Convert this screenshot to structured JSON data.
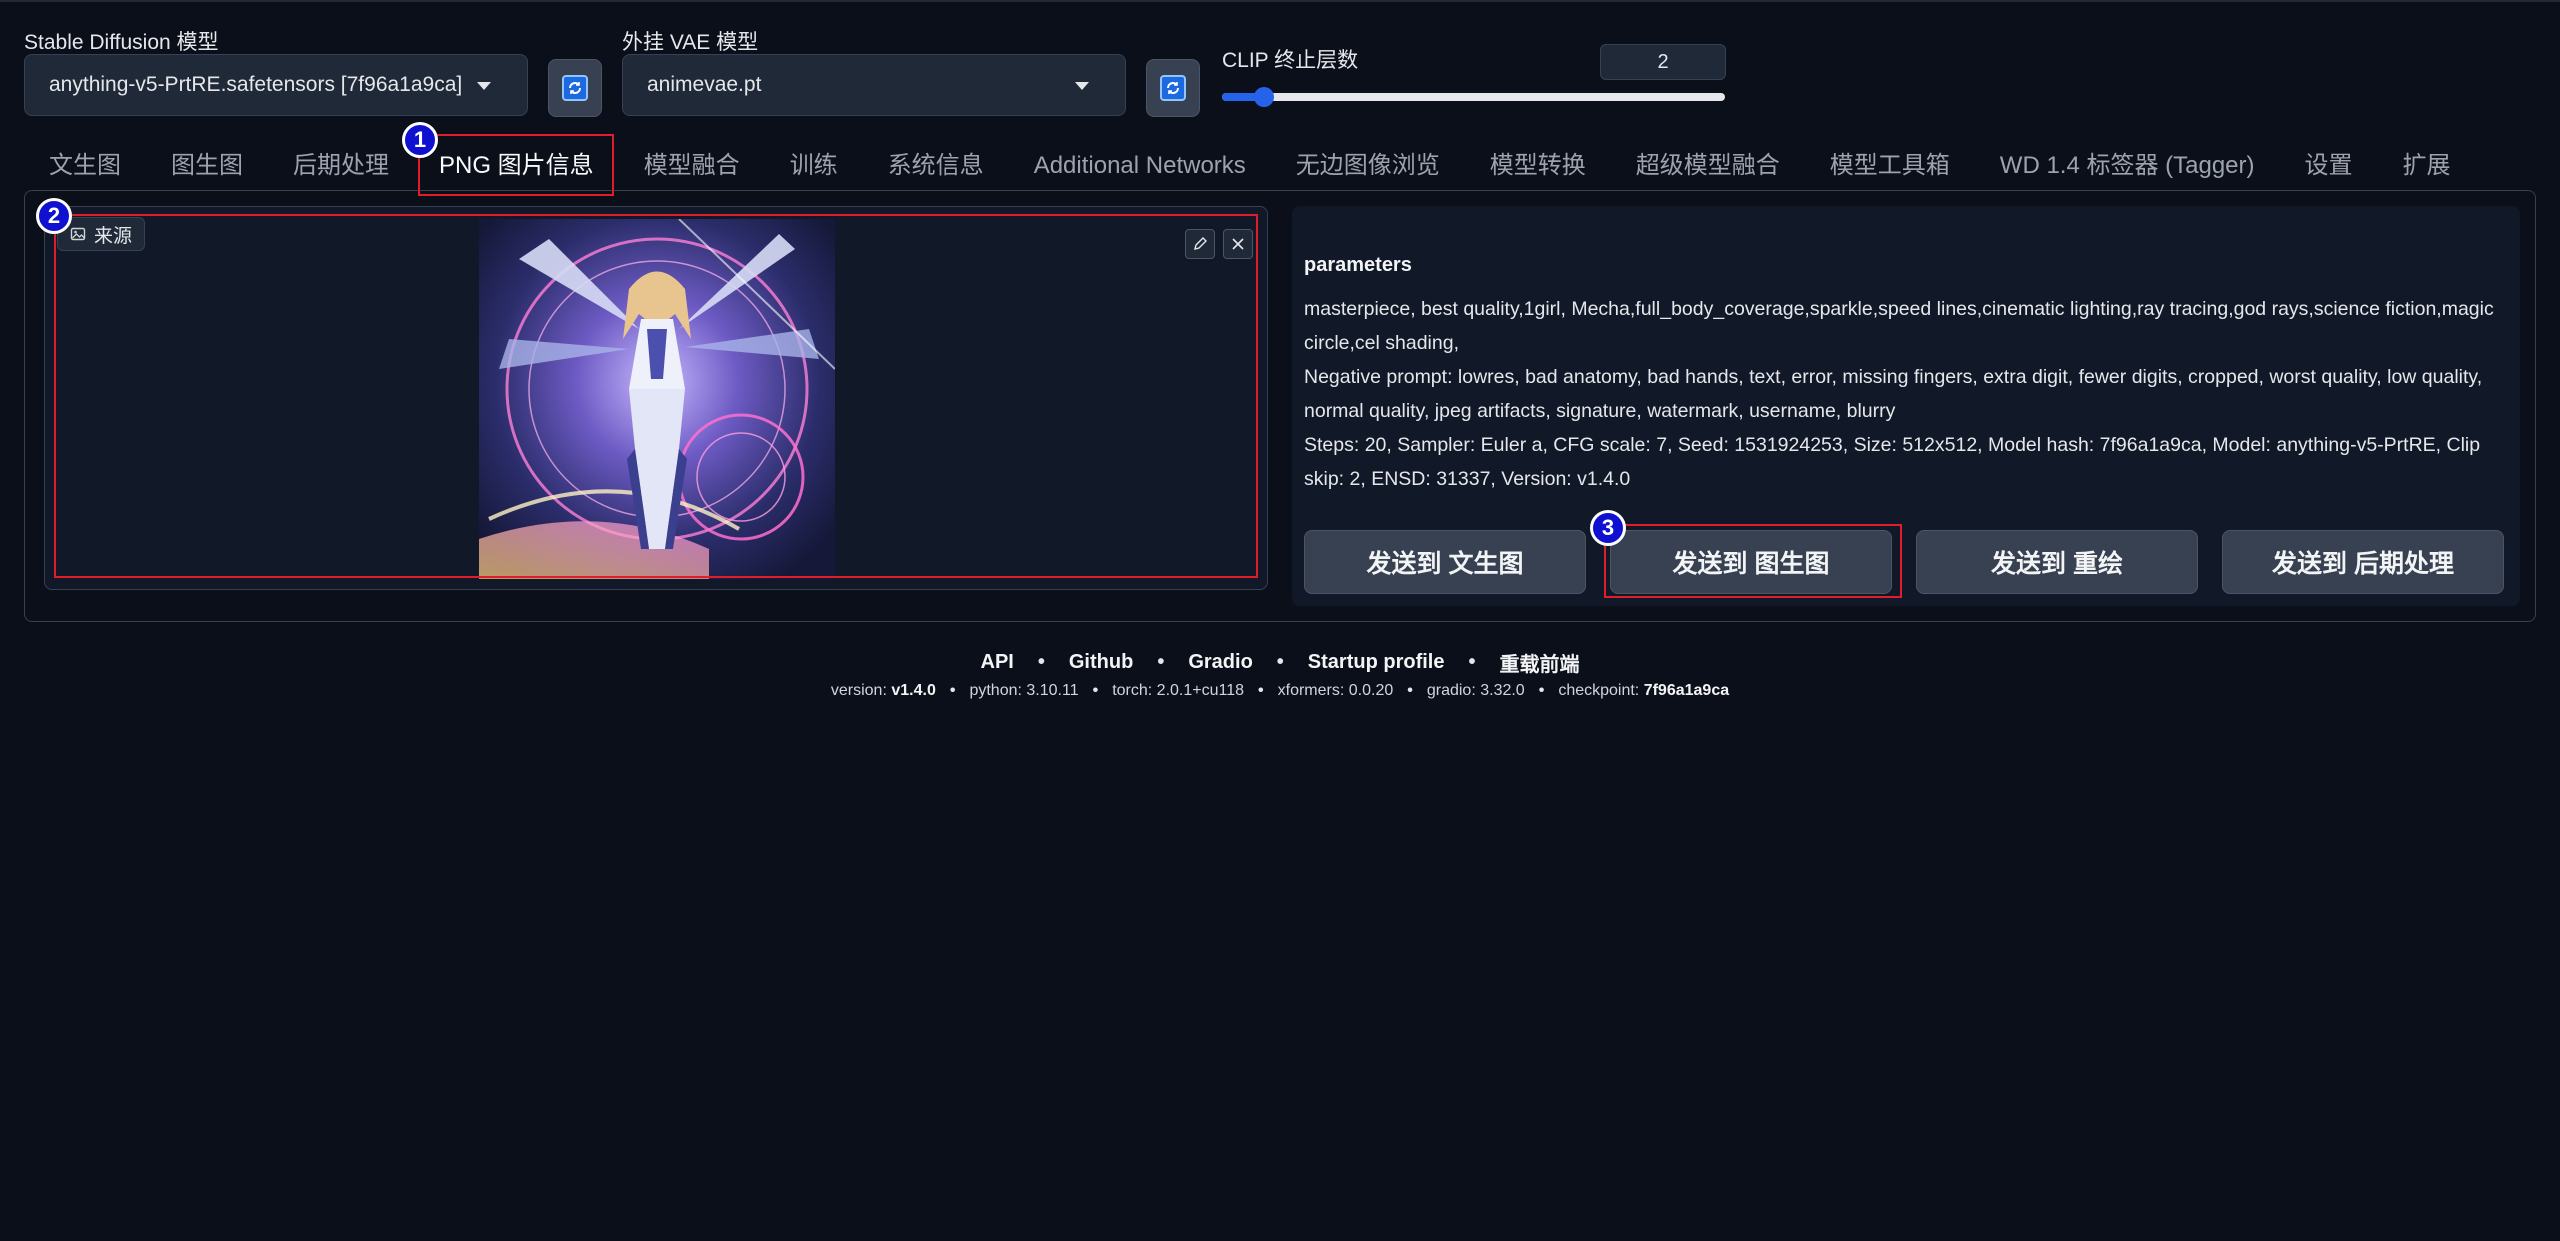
{
  "header": {
    "sd_model_label": "Stable Diffusion 模型",
    "sd_model_value": "anything-v5-PrtRE.safetensors [7f96a1a9ca]",
    "vae_label": "外挂 VAE 模型",
    "vae_value": "animevae.pt",
    "clip_label": "CLIP 终止层数",
    "clip_value": "2",
    "clip_slider_fraction": 0.083
  },
  "tabs": [
    {
      "label": "文生图"
    },
    {
      "label": "图生图"
    },
    {
      "label": "后期处理"
    },
    {
      "label": "PNG 图片信息",
      "active": true
    },
    {
      "label": "模型融合"
    },
    {
      "label": "训练"
    },
    {
      "label": "系统信息"
    },
    {
      "label": "Additional Networks"
    },
    {
      "label": "无边图像浏览"
    },
    {
      "label": "模型转换"
    },
    {
      "label": "超级模型融合"
    },
    {
      "label": "模型工具箱"
    },
    {
      "label": "WD 1.4 标签器 (Tagger)"
    },
    {
      "label": "设置"
    },
    {
      "label": "扩展"
    }
  ],
  "image_panel": {
    "source_label": "来源"
  },
  "info_panel": {
    "title": "parameters",
    "prompt": "masterpiece, best quality,1girl, Mecha,full_body_coverage,sparkle,speed lines,cinematic lighting,ray tracing,god rays,science fiction,magic circle,cel shading,",
    "negative": "Negative prompt: lowres, bad anatomy, bad hands, text, error, missing fingers, extra digit, fewer digits, cropped, worst quality, low quality, normal quality, jpeg artifacts, signature, watermark, username, blurry",
    "settings": "Steps: 20, Sampler: Euler a, CFG scale: 7, Seed: 1531924253, Size: 512x512, Model hash: 7f96a1a9ca, Model: anything-v5-PrtRE, Clip skip: 2, ENSD: 31337, Version: v1.4.0",
    "buttons": {
      "txt2img": "发送到 文生图",
      "img2img": "发送到 图生图",
      "inpaint": "发送到 重绘",
      "extras": "发送到 后期处理"
    }
  },
  "annotations": [
    "1",
    "2",
    "3"
  ],
  "footer": {
    "links": [
      "API",
      "Github",
      "Gradio",
      "Startup profile",
      "重载前端"
    ],
    "dot": "•",
    "versions": {
      "version_label": "version:",
      "version": "v1.4.0",
      "python_label": "python:",
      "python": "3.10.11",
      "torch_label": "torch:",
      "torch": "2.0.1+cu118",
      "xformers_label": "xformers:",
      "xformers": "0.0.20",
      "gradio_label": "gradio:",
      "gradio": "3.32.0",
      "checkpoint_label": "checkpoint:",
      "checkpoint": "7f96a1a9ca"
    }
  },
  "colors": {
    "background": "#0b0f19",
    "panel": "#111827",
    "accent": "#2563eb",
    "annotation_red": "#e11d2b",
    "annotation_badge": "#1010d0"
  }
}
